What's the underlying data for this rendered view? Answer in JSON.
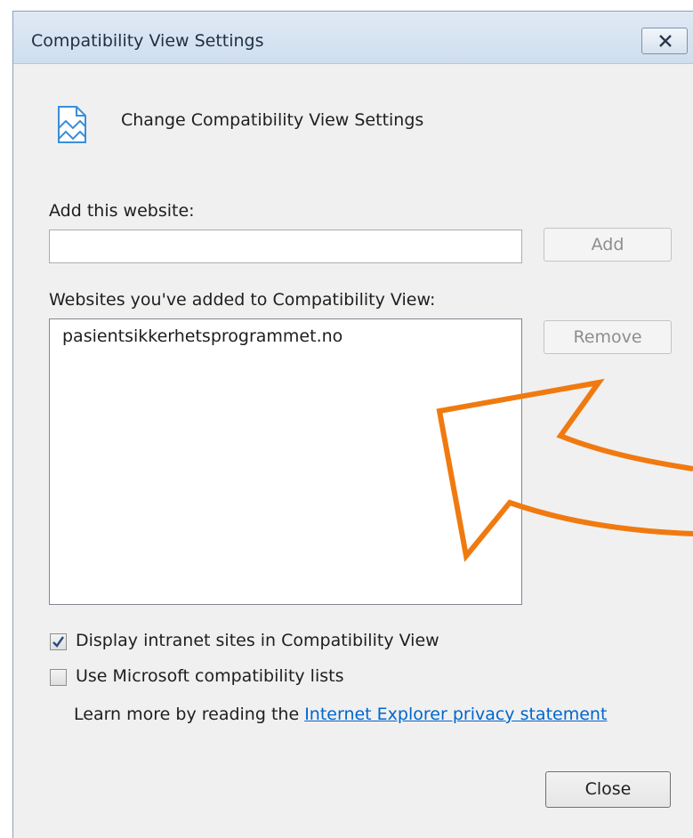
{
  "window": {
    "title": "Compatibility View Settings"
  },
  "header": {
    "text": "Change Compatibility View Settings"
  },
  "add_website": {
    "label": "Add this website:",
    "value": "",
    "button": "Add"
  },
  "websites": {
    "label": "Websites you've added to Compatibility View:",
    "items": [
      "pasientsikkerhetsprogrammet.no"
    ],
    "remove_button": "Remove"
  },
  "options": {
    "intranet": {
      "label": "Display intranet sites in Compatibility View",
      "checked": true
    },
    "ms_lists": {
      "label": "Use Microsoft compatibility lists",
      "checked": false
    }
  },
  "learn_more": {
    "text": "Learn more by reading the",
    "link": "Internet Explorer privacy statement"
  },
  "close_button": "Close",
  "colors": {
    "annotation_arrow": "#f07a10",
    "link": "#0066cc"
  }
}
